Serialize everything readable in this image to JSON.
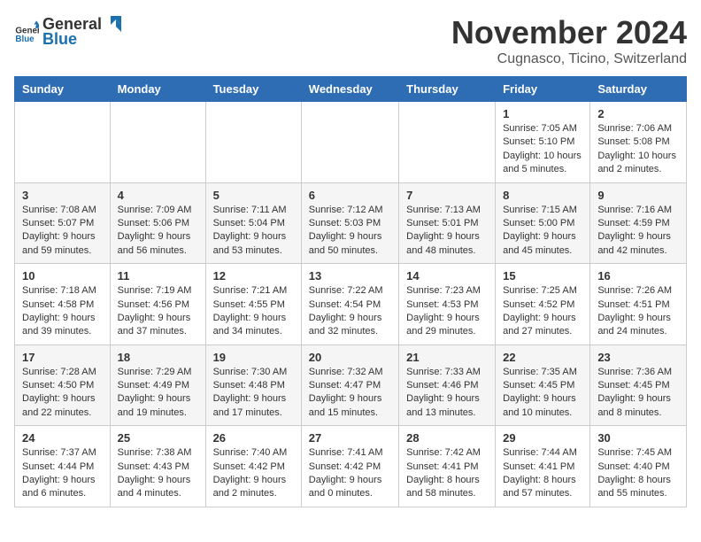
{
  "logo": {
    "text_general": "General",
    "text_blue": "Blue"
  },
  "title": {
    "month": "November 2024",
    "location": "Cugnasco, Ticino, Switzerland"
  },
  "headers": [
    "Sunday",
    "Monday",
    "Tuesday",
    "Wednesday",
    "Thursday",
    "Friday",
    "Saturday"
  ],
  "weeks": [
    [
      {
        "day": "",
        "info": ""
      },
      {
        "day": "",
        "info": ""
      },
      {
        "day": "",
        "info": ""
      },
      {
        "day": "",
        "info": ""
      },
      {
        "day": "",
        "info": ""
      },
      {
        "day": "1",
        "info": "Sunrise: 7:05 AM\nSunset: 5:10 PM\nDaylight: 10 hours and 5 minutes."
      },
      {
        "day": "2",
        "info": "Sunrise: 7:06 AM\nSunset: 5:08 PM\nDaylight: 10 hours and 2 minutes."
      }
    ],
    [
      {
        "day": "3",
        "info": "Sunrise: 7:08 AM\nSunset: 5:07 PM\nDaylight: 9 hours and 59 minutes."
      },
      {
        "day": "4",
        "info": "Sunrise: 7:09 AM\nSunset: 5:06 PM\nDaylight: 9 hours and 56 minutes."
      },
      {
        "day": "5",
        "info": "Sunrise: 7:11 AM\nSunset: 5:04 PM\nDaylight: 9 hours and 53 minutes."
      },
      {
        "day": "6",
        "info": "Sunrise: 7:12 AM\nSunset: 5:03 PM\nDaylight: 9 hours and 50 minutes."
      },
      {
        "day": "7",
        "info": "Sunrise: 7:13 AM\nSunset: 5:01 PM\nDaylight: 9 hours and 48 minutes."
      },
      {
        "day": "8",
        "info": "Sunrise: 7:15 AM\nSunset: 5:00 PM\nDaylight: 9 hours and 45 minutes."
      },
      {
        "day": "9",
        "info": "Sunrise: 7:16 AM\nSunset: 4:59 PM\nDaylight: 9 hours and 42 minutes."
      }
    ],
    [
      {
        "day": "10",
        "info": "Sunrise: 7:18 AM\nSunset: 4:58 PM\nDaylight: 9 hours and 39 minutes."
      },
      {
        "day": "11",
        "info": "Sunrise: 7:19 AM\nSunset: 4:56 PM\nDaylight: 9 hours and 37 minutes."
      },
      {
        "day": "12",
        "info": "Sunrise: 7:21 AM\nSunset: 4:55 PM\nDaylight: 9 hours and 34 minutes."
      },
      {
        "day": "13",
        "info": "Sunrise: 7:22 AM\nSunset: 4:54 PM\nDaylight: 9 hours and 32 minutes."
      },
      {
        "day": "14",
        "info": "Sunrise: 7:23 AM\nSunset: 4:53 PM\nDaylight: 9 hours and 29 minutes."
      },
      {
        "day": "15",
        "info": "Sunrise: 7:25 AM\nSunset: 4:52 PM\nDaylight: 9 hours and 27 minutes."
      },
      {
        "day": "16",
        "info": "Sunrise: 7:26 AM\nSunset: 4:51 PM\nDaylight: 9 hours and 24 minutes."
      }
    ],
    [
      {
        "day": "17",
        "info": "Sunrise: 7:28 AM\nSunset: 4:50 PM\nDaylight: 9 hours and 22 minutes."
      },
      {
        "day": "18",
        "info": "Sunrise: 7:29 AM\nSunset: 4:49 PM\nDaylight: 9 hours and 19 minutes."
      },
      {
        "day": "19",
        "info": "Sunrise: 7:30 AM\nSunset: 4:48 PM\nDaylight: 9 hours and 17 minutes."
      },
      {
        "day": "20",
        "info": "Sunrise: 7:32 AM\nSunset: 4:47 PM\nDaylight: 9 hours and 15 minutes."
      },
      {
        "day": "21",
        "info": "Sunrise: 7:33 AM\nSunset: 4:46 PM\nDaylight: 9 hours and 13 minutes."
      },
      {
        "day": "22",
        "info": "Sunrise: 7:35 AM\nSunset: 4:45 PM\nDaylight: 9 hours and 10 minutes."
      },
      {
        "day": "23",
        "info": "Sunrise: 7:36 AM\nSunset: 4:45 PM\nDaylight: 9 hours and 8 minutes."
      }
    ],
    [
      {
        "day": "24",
        "info": "Sunrise: 7:37 AM\nSunset: 4:44 PM\nDaylight: 9 hours and 6 minutes."
      },
      {
        "day": "25",
        "info": "Sunrise: 7:38 AM\nSunset: 4:43 PM\nDaylight: 9 hours and 4 minutes."
      },
      {
        "day": "26",
        "info": "Sunrise: 7:40 AM\nSunset: 4:42 PM\nDaylight: 9 hours and 2 minutes."
      },
      {
        "day": "27",
        "info": "Sunrise: 7:41 AM\nSunset: 4:42 PM\nDaylight: 9 hours and 0 minutes."
      },
      {
        "day": "28",
        "info": "Sunrise: 7:42 AM\nSunset: 4:41 PM\nDaylight: 8 hours and 58 minutes."
      },
      {
        "day": "29",
        "info": "Sunrise: 7:44 AM\nSunset: 4:41 PM\nDaylight: 8 hours and 57 minutes."
      },
      {
        "day": "30",
        "info": "Sunrise: 7:45 AM\nSunset: 4:40 PM\nDaylight: 8 hours and 55 minutes."
      }
    ]
  ]
}
